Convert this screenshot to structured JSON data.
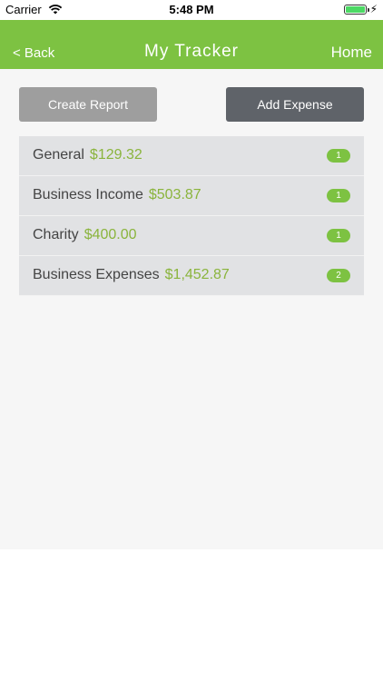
{
  "status_bar": {
    "carrier": "Carrier",
    "time": "5:48 PM",
    "battery_level": 1.0
  },
  "nav": {
    "back_label": "< Back",
    "title": "My Tracker",
    "home_label": "Home"
  },
  "actions": {
    "create_report_label": "Create Report",
    "add_expense_label": "Add Expense"
  },
  "categories": [
    {
      "name": "General",
      "amount": "$129.32",
      "count": "1"
    },
    {
      "name": "Business Income",
      "amount": "$503.87",
      "count": "1"
    },
    {
      "name": "Charity",
      "amount": "$400.00",
      "count": "1"
    },
    {
      "name": "Business Expenses",
      "amount": "$1,452.87",
      "count": "2"
    }
  ],
  "colors": {
    "accent": "#7dc242",
    "amount": "#8ab43c",
    "primary_button": "#5f6369",
    "secondary_button": "#9e9e9e"
  }
}
